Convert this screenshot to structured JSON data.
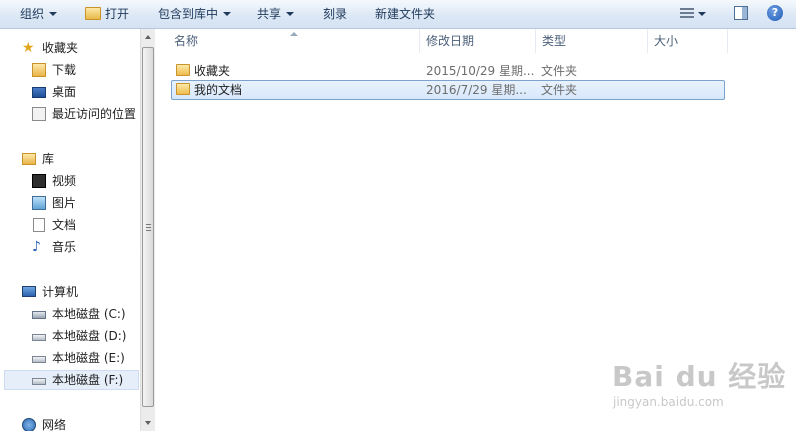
{
  "toolbar": {
    "organize": "组织",
    "open": "打开",
    "include_in_library": "包含到库中",
    "share": "共享",
    "burn": "刻录",
    "new_folder": "新建文件夹",
    "help": "?"
  },
  "nav": {
    "favorites": {
      "label": "收藏夹",
      "items": [
        "下载",
        "桌面",
        "最近访问的位置"
      ]
    },
    "libraries": {
      "label": "库",
      "items": [
        "视频",
        "图片",
        "文档",
        "音乐"
      ]
    },
    "computer": {
      "label": "计算机",
      "items": [
        "本地磁盘 (C:)",
        "本地磁盘 (D:)",
        "本地磁盘 (E:)",
        "本地磁盘 (F:)"
      ],
      "selected": "本地磁盘 (F:)"
    },
    "network": {
      "label": "网络"
    }
  },
  "columns": [
    "名称",
    "修改日期",
    "类型",
    "大小"
  ],
  "files": [
    {
      "name": "收藏夹",
      "date": "2015/10/29 星期...",
      "type": "文件夹",
      "size": ""
    },
    {
      "name": "我的文档",
      "date": "2016/7/29 星期...",
      "type": "文件夹",
      "size": "",
      "selected": true
    }
  ],
  "watermark": {
    "main": "Bai du 经验",
    "sub": "jingyan.baidu.com"
  },
  "colors": {
    "toolbar_bg": "#dde8f5",
    "selection": "#d7e7fb",
    "selection_border": "#7da2ce",
    "folder": "#eebc4f"
  }
}
